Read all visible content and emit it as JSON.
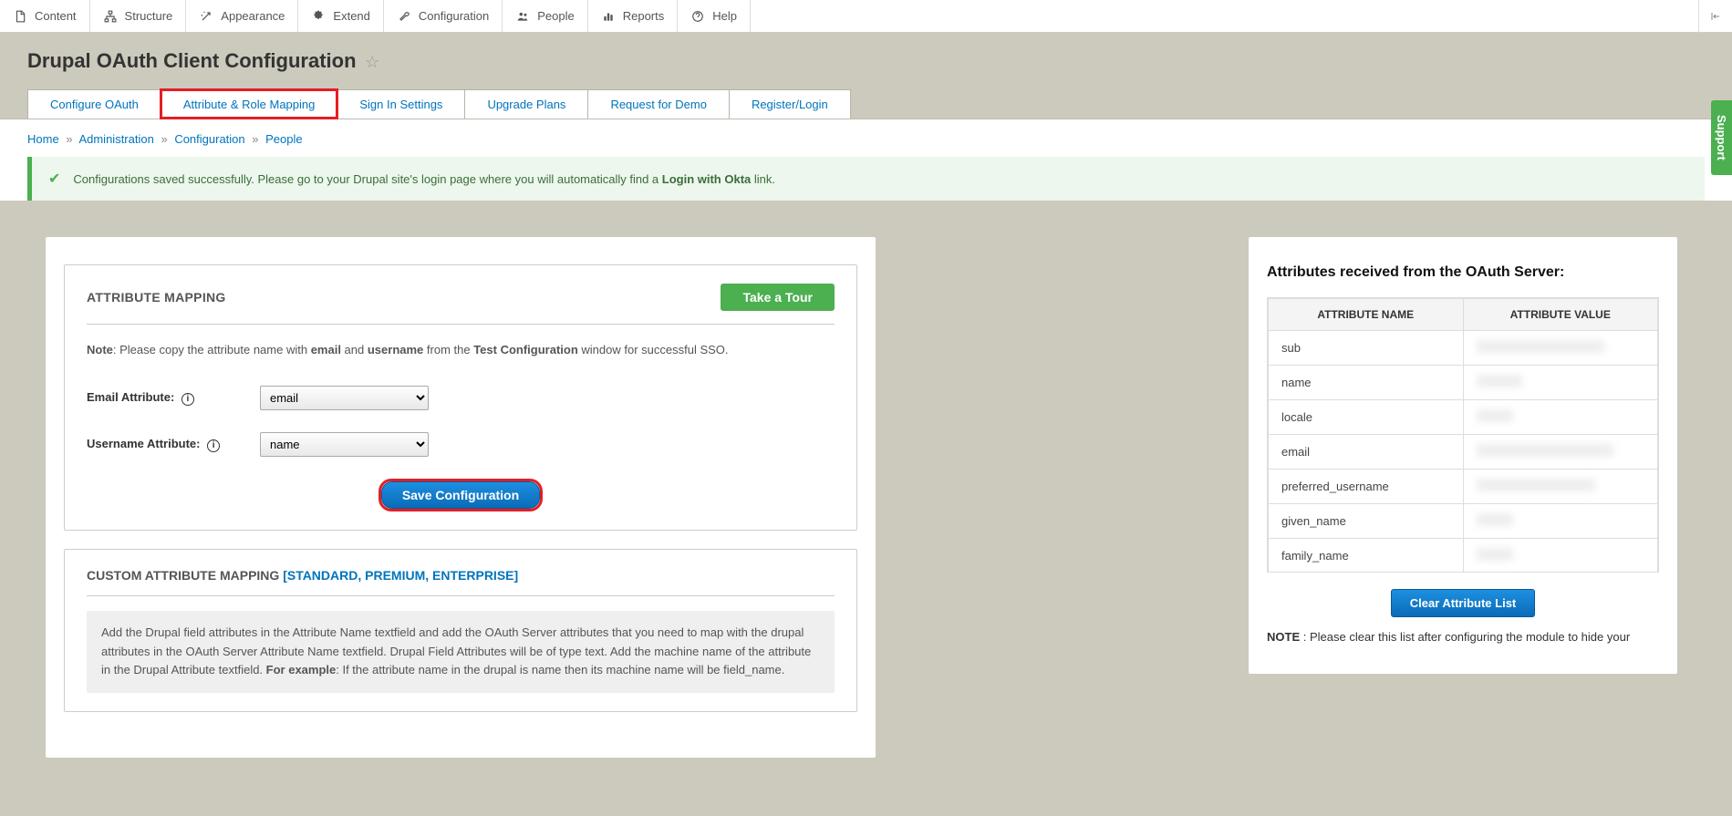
{
  "adminBar": {
    "items": [
      {
        "label": "Content",
        "icon": "file-icon"
      },
      {
        "label": "Structure",
        "icon": "structure-icon"
      },
      {
        "label": "Appearance",
        "icon": "wand-icon"
      },
      {
        "label": "Extend",
        "icon": "puzzle-icon"
      },
      {
        "label": "Configuration",
        "icon": "wrench-icon"
      },
      {
        "label": "People",
        "icon": "people-icon"
      },
      {
        "label": "Reports",
        "icon": "chart-icon"
      },
      {
        "label": "Help",
        "icon": "help-icon"
      }
    ]
  },
  "pageTitle": "Drupal OAuth Client Configuration",
  "tabs": [
    {
      "label": "Configure OAuth"
    },
    {
      "label": "Attribute & Role Mapping",
      "highlight": true
    },
    {
      "label": "Sign In Settings"
    },
    {
      "label": "Upgrade Plans"
    },
    {
      "label": "Request for Demo"
    },
    {
      "label": "Register/Login"
    }
  ],
  "breadcrumb": {
    "items": [
      "Home",
      "Administration",
      "Configuration",
      "People"
    ]
  },
  "statusMessage": {
    "prefix": "Configurations saved successfully. Please go to your Drupal site's login page where you will automatically find a ",
    "bold": "Login with Okta",
    "suffix": " link."
  },
  "attributeMapping": {
    "heading": "ATTRIBUTE MAPPING",
    "takeTourLabel": "Take a Tour",
    "note": {
      "boldLead": "Note",
      "text1": ": Please copy the attribute name with ",
      "b1": "email",
      "text2": " and ",
      "b2": "username",
      "text3": " from the ",
      "b3": "Test Configuration",
      "text4": " window for successful SSO."
    },
    "emailLabel": "Email Attribute:",
    "emailValue": "email",
    "usernameLabel": "Username Attribute:",
    "usernameValue": "name",
    "saveLabel": "Save Configuration"
  },
  "customMapping": {
    "heading": "CUSTOM ATTRIBUTE MAPPING ",
    "plans": "[STANDARD, PREMIUM, ENTERPRISE]",
    "infoText1": "Add the Drupal field attributes in the Attribute Name textfield and add the OAuth Server attributes that you need to map with the drupal attributes in the OAuth Server Attribute Name textfield. Drupal Field Attributes will be of type text. Add the machine name of the attribute in the Drupal Attribute textfield. ",
    "infoBold1": "For example",
    "infoText2": ": If the attribute name in the drupal is name then its machine name will be field_name."
  },
  "rightPanel": {
    "heading": "Attributes received from the OAuth Server:",
    "thName": "ATTRIBUTE NAME",
    "thValue": "ATTRIBUTE VALUE",
    "rows": [
      {
        "name": "sub",
        "valueHidden": true
      },
      {
        "name": "name",
        "valueHidden": true
      },
      {
        "name": "locale",
        "valueHidden": true
      },
      {
        "name": "email",
        "valueHidden": true
      },
      {
        "name": "preferred_username",
        "valueHidden": true
      },
      {
        "name": "given_name",
        "valueHidden": true
      },
      {
        "name": "family_name",
        "valueHidden": true
      }
    ],
    "clearLabel": "Clear Attribute List",
    "noteBold": "NOTE",
    "noteText": " : Please clear this list after configuring the module to hide your"
  },
  "supportTabLabel": "Support"
}
